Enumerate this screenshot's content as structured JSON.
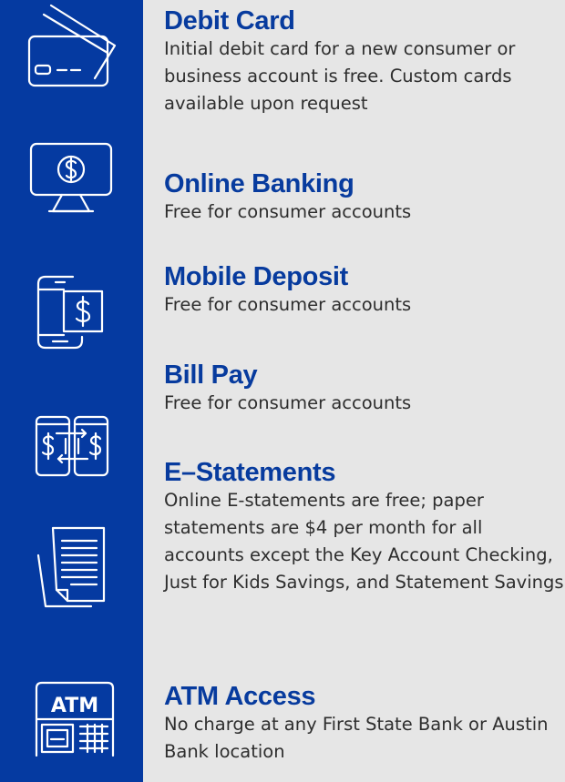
{
  "brand": {
    "sidebar_color": "#053aa1",
    "title_color": "#073b9e",
    "background_color": "#e6e6e6"
  },
  "icons": [
    {
      "name": "debit-card-icon"
    },
    {
      "name": "online-banking-monitor-icon"
    },
    {
      "name": "mobile-deposit-phone-icon"
    },
    {
      "name": "bill-pay-transfer-icon"
    },
    {
      "name": "e-statements-document-icon"
    },
    {
      "name": "atm-machine-icon",
      "text": "ATM"
    }
  ],
  "services": [
    {
      "title": "Debit Card",
      "description": "Initial debit card for a new consumer or business account is free. Custom cards available upon request"
    },
    {
      "title": "Online Banking",
      "description": "Free for consumer accounts"
    },
    {
      "title": "Mobile Deposit",
      "description": "Free for consumer accounts"
    },
    {
      "title": "Bill Pay",
      "description": "Free for consumer accounts"
    },
    {
      "title": "E–Statements",
      "description": "Online E-statements are free; paper statements are $4 per month for all accounts except the Key Account Checking, Just for Kids Savings, and Statement Savings"
    },
    {
      "title": "ATM Access",
      "description": "No charge at any First State Bank or Austin Bank location"
    }
  ]
}
